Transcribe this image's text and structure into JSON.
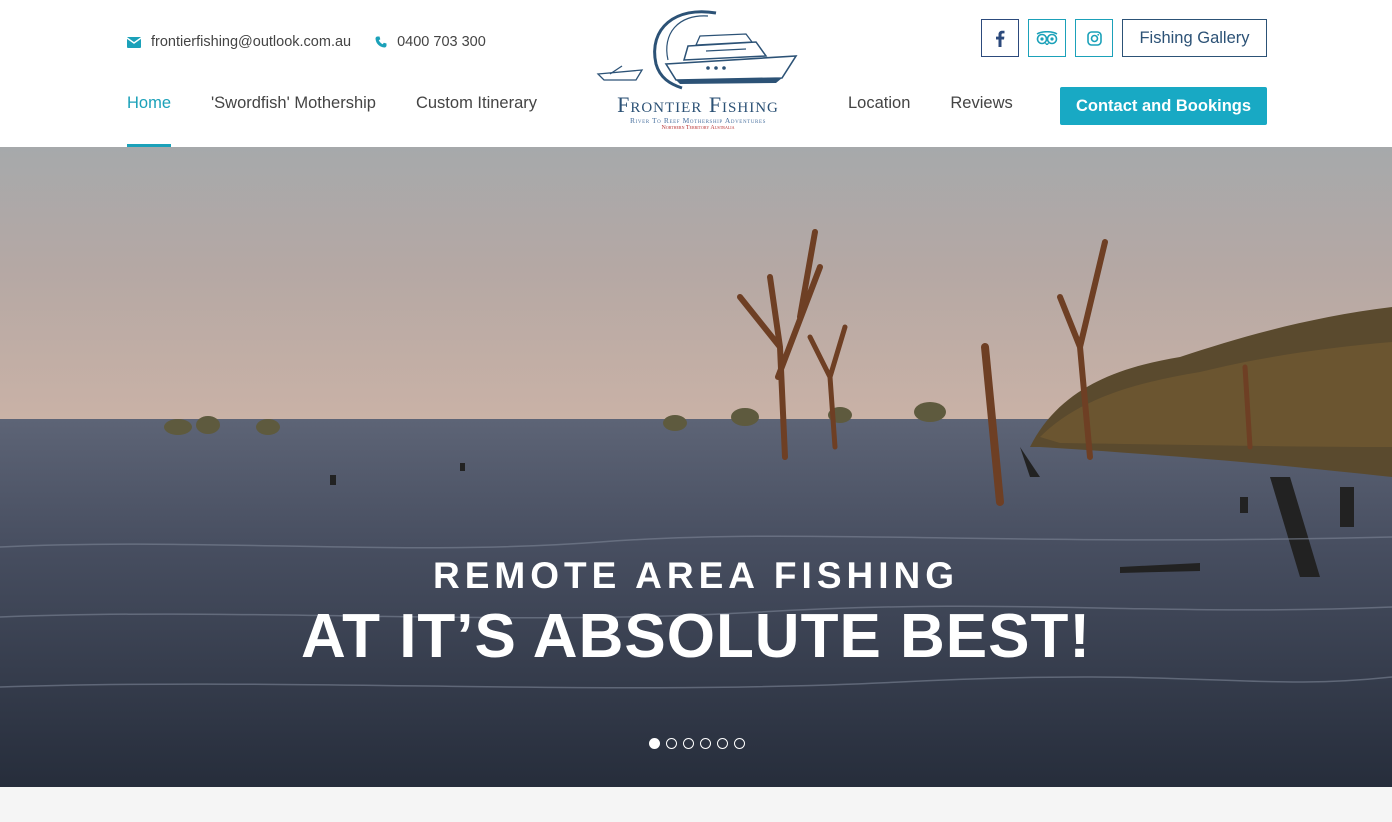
{
  "contact": {
    "email": "frontierfishing@outlook.com.au",
    "phone": "0400 703 300"
  },
  "nav": {
    "left": [
      {
        "label": "Home",
        "active": true
      },
      {
        "label": "'Swordfish' Mothership"
      },
      {
        "label": "Custom Itinerary"
      }
    ],
    "right": [
      {
        "label": "Location"
      },
      {
        "label": "Reviews"
      }
    ]
  },
  "logo": {
    "title": "Frontier Fishing",
    "subtitle": "River To Reef Mothership Adventures",
    "region": "Northern Territory Australia"
  },
  "social": {
    "facebook_icon": "facebook-icon",
    "tripadvisor_icon": "tripadvisor-icon",
    "instagram_icon": "instagram-icon"
  },
  "buttons": {
    "gallery": "Fishing Gallery",
    "contact": "Contact and Bookings"
  },
  "hero": {
    "subtitle": "REMOTE AREA FISHING",
    "title": "AT IT’S ABSOLUTE BEST!",
    "slides": 6,
    "active_slide": 1
  },
  "colors": {
    "accent": "#1ba1b9",
    "brand_navy": "#2c5276"
  }
}
